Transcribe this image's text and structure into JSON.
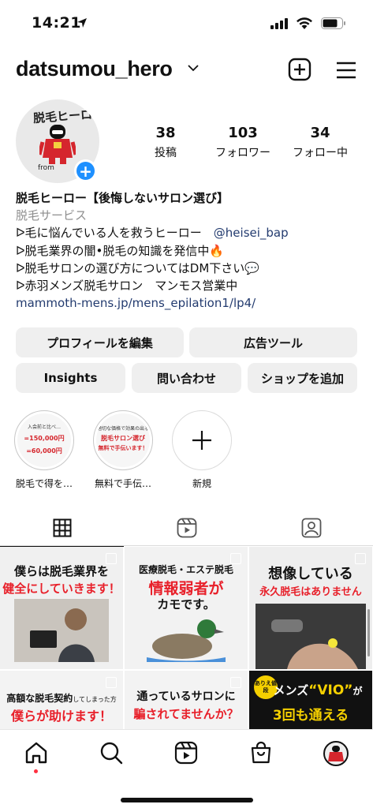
{
  "status_bar": {
    "time": "14:21"
  },
  "header": {
    "username": "datsumou_hero"
  },
  "profile": {
    "avatar_text": "脱毛ヒーロー",
    "avatar_from": "from",
    "stats": [
      {
        "value": "38",
        "label": "投稿"
      },
      {
        "value": "103",
        "label": "フォロワー"
      },
      {
        "value": "34",
        "label": "フォロー中"
      }
    ]
  },
  "bio": {
    "name": "脱毛ヒーロー【後悔しないサロン選び】",
    "category": "脱毛サービス",
    "line1_text": "ᐅ毛に悩んでいる人を救うヒーロー　",
    "line1_mention": "@heisei_bap",
    "line2": "ᐅ脱毛業界の闇•脱毛の知識を発信中🔥",
    "line3": "ᐅ脱毛サロンの選び方についてはDM下さい💬",
    "line4": "ᐅ赤羽メンズ脱毛サロン　マンモス営業中",
    "link": "mammoth-mens.jp/mens_epilation1/lp4/"
  },
  "buttons": {
    "edit_profile": "プロフィールを編集",
    "ad_tools": "広告ツール",
    "insights": "Insights",
    "contact": "問い合わせ",
    "add_shop": "ショップを追加"
  },
  "highlights": [
    {
      "label": "脱毛で得を…",
      "lines": [
        "入会前と比べ…",
        "=150,000円",
        "=60,000円"
      ]
    },
    {
      "label": "無料で手伝…",
      "lines": [
        "適切な価格で効果の出る",
        "脱毛サロン選び",
        "無料で手伝います！"
      ]
    },
    {
      "label": "新規"
    }
  ],
  "posts": [
    {
      "line1": "僕らは脱毛業界を",
      "line2": "健全にしていきます！"
    },
    {
      "line1": "医療脱毛・エステ脱毛",
      "line2": "情報弱者が",
      "line3": "カモです。"
    },
    {
      "line1": "想像している",
      "line2": "永久脱毛はありません"
    },
    {
      "line1": "高額な脱毛契約",
      "line1b": "してしまった方",
      "line2": "僕らが助けます！"
    },
    {
      "line1": "通っているサロンに",
      "line2": "騙されてませんか？"
    },
    {
      "badge": "ありえ値段",
      "line1": "メンズ",
      "line1b": "“VIO”",
      "line1c": "が",
      "line2": "3回も通える"
    }
  ],
  "colors": {
    "accent_red": "#e8202a",
    "link_blue": "#233b6f",
    "badge_blue": "#1e90ff"
  }
}
